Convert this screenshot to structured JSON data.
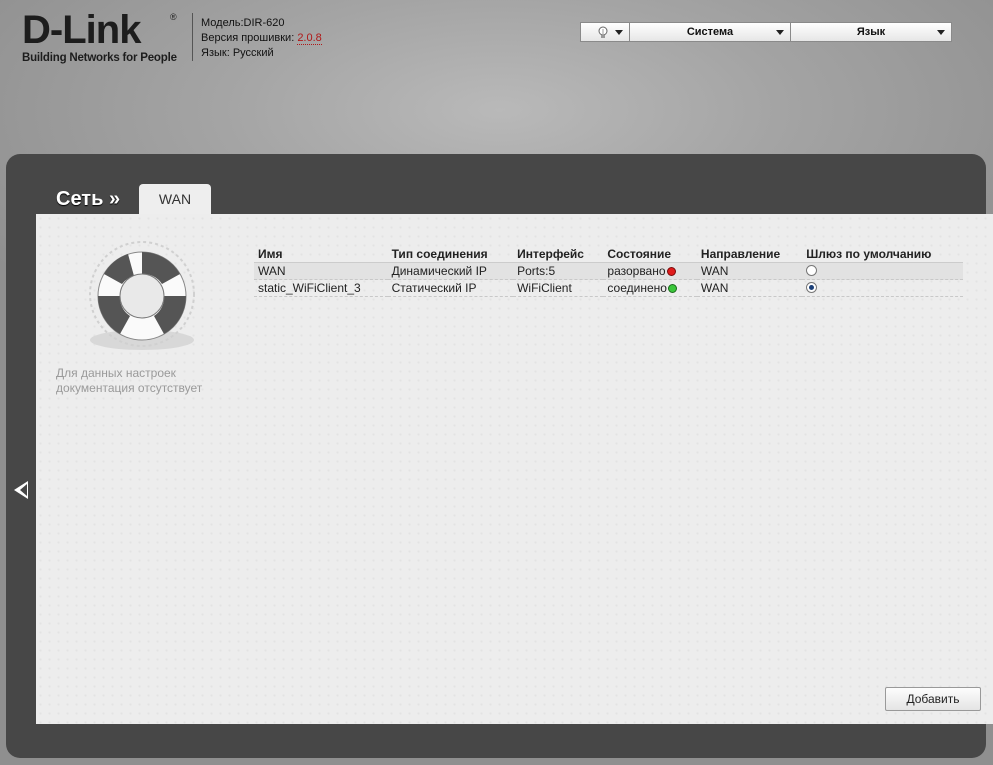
{
  "header": {
    "logo_text": "D-Link",
    "logo_reg": "®",
    "logo_tagline": "Building Networks for People",
    "model_line": "Модель:DIR-620",
    "firmware_label": "Версия прошивки: ",
    "firmware_value": "2.0.8",
    "language_line": "Язык: Русский",
    "firmware_color": "#b01818"
  },
  "topmenu": {
    "help_icon": "lightbulb-icon",
    "system_label": "Система",
    "language_label": "Язык"
  },
  "page": {
    "breadcrumb": "Сеть »",
    "tab_label": "WAN",
    "help_text": "Для данных настроек документация отсутствует",
    "help_icon": "lifebuoy-icon",
    "collapse_icon": "chevron-left-icon",
    "add_button": "Добавить"
  },
  "table": {
    "columns": [
      "Имя",
      "Тип соединения",
      "Интерфейс",
      "Состояние",
      "Направление",
      "Шлюз по умолчанию"
    ],
    "rows": [
      {
        "name": "WAN",
        "type": "Динамический IP",
        "interface": "Ports:5",
        "state": "разорвано",
        "state_color": "#e01b1b",
        "direction": "WAN",
        "default_gw": false
      },
      {
        "name": "static_WiFiClient_3",
        "type": "Статический IP",
        "interface": "WiFiClient",
        "state": "соединено",
        "state_color": "#3ac63a",
        "direction": "WAN",
        "default_gw": true
      }
    ]
  }
}
